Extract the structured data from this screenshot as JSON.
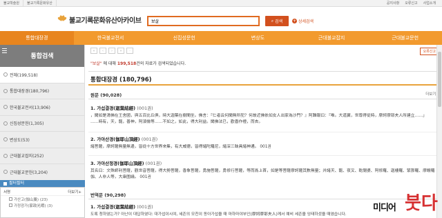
{
  "topbar": {
    "links": [
      "불교학술원",
      "불교기록문화유산"
    ],
    "right_links": [
      "공지사항",
      "오류신고",
      "사업소개"
    ]
  },
  "header": {
    "title": "불교기록문화유산아카이브",
    "search_value": "보살",
    "search_button": "검색",
    "advanced": "상세검색"
  },
  "nav": {
    "items": [
      "통합대장경",
      "한국불교전서",
      "신집성문헌",
      "변상도",
      "근대불교잡지",
      "근대불교문헌"
    ]
  },
  "sidebar": {
    "title": "통합검색",
    "items": [
      "전체(199,518)",
      "통합대장경(180,796)",
      "한국불교전서(13,906)",
      "신집성문헌(1,305)",
      "변상도(53)",
      "근대불교잡지(252)",
      "근대불교문헌(3,204)"
    ],
    "filter_label": "필터필터",
    "filter_rows": [
      {
        "label": "서명",
        "more": "더보기+"
      },
      {
        "label": "가산고(伽山藁) (23)"
      },
      {
        "label": "가정광가(家政光暇) (3)"
      }
    ]
  },
  "main": {
    "pager": [
      "«",
      "‹",
      "›",
      "»",
      "·"
    ],
    "export_btn": "오류신고",
    "summary_q": "\"보살\"",
    "summary_mid": " 에 대해 ",
    "summary_n": "199,518",
    "summary_tail": "건의 자료가 검색되었습니다.",
    "section_title": "통합대장경 (180,796)",
    "sub_title": "원문 (90,028)",
    "more": "더보기+",
    "entries": [
      {
        "title": "1. 가섭결경(迦葉結經)",
        "vol": " (001권)",
        "body1": "，聞如是淸佛在王舍國，與五百比丘俱，時大迦葉在樹間坐。佛言：『仁者云何聞無所犯？何故近佛依如女人出家為沙門？』阿難報曰：『唯。大道翼，世尊得從時，摩訶摩耶夫人所建立……」",
        "body2": "……時有，天，龍，善神，阿須倫等……不如之，如此，得大利益。聞佛法已，歡喜作禮，而去。"
      },
      {
        "title": "2. 가아산경(伽耶山頂經)",
        "vol": " (001권)",
        "body1": "諸菩薩，摩訶薩無量無邊，皆從十方世界來集，有大威德，皆得諸陀羅尼，諸深三昧具諸神通。 001권"
      },
      {
        "title": "3. 가아산정경(伽耶山頂經)",
        "vol": " (001권)",
        "body1": "其名曰：文殊師利菩薩，觀世音菩薩，得大勢菩薩，香象菩薩，勇施菩薩，勇修行菩薩，等而爲上首，如是等菩薩摩訶薩其數無量；并諸天、龍、夜叉、乾闥婆、阿修羅、迦樓羅、緊那羅、摩睺羅伽、人非人等，大衆圍繞。 001권"
      }
    ],
    "sub2_title": "번역문 (90,298)",
    "entry4": {
      "title": "1. 가섭결경(迦葉結經)",
      "vol": " (001권)",
      "body1": "도록 청하였는가? 아난이 대답하였다: 대가섭이시여, 세존의 모친이 동아가섭을 때 마하마야부인(摩訶摩耶夫人)께서 예비 세존을 잉태하셨을 때였습니다."
    }
  },
  "watermark": {
    "w1": "미디어",
    "w2": "붓다"
  }
}
